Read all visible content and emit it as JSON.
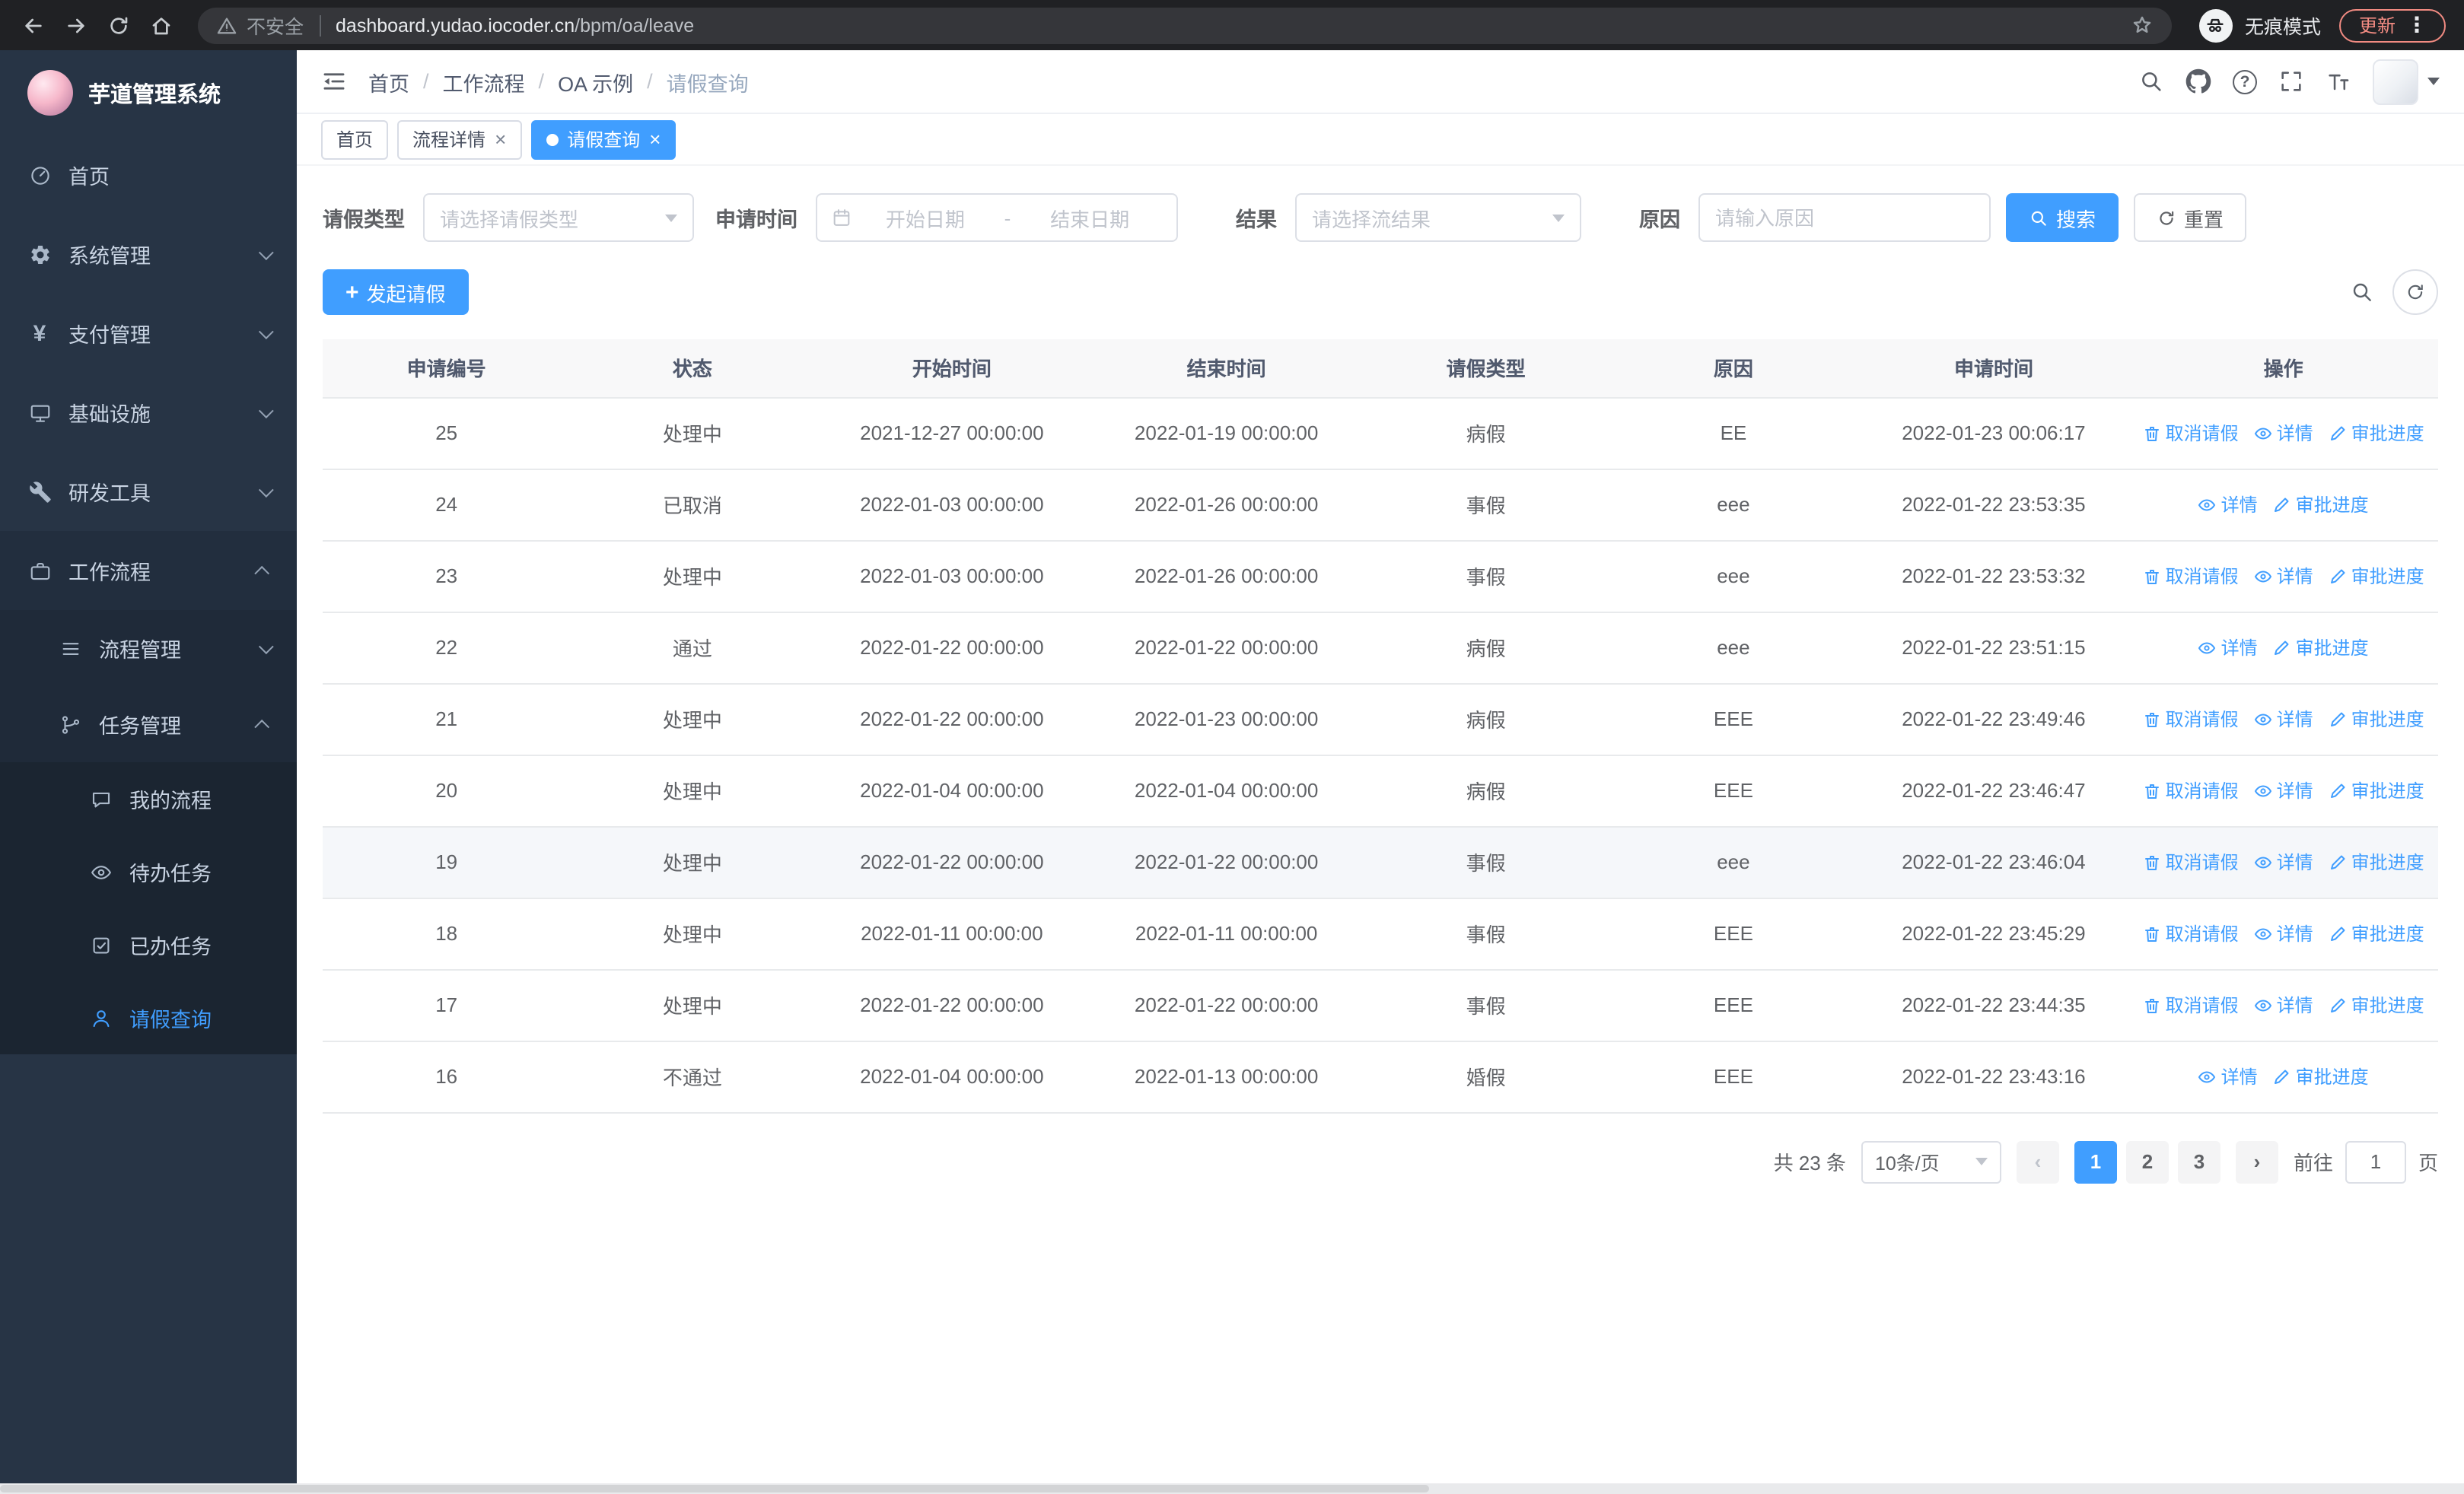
{
  "browser": {
    "security_label": "不安全",
    "url_host": "dashboard.yudao.iocoder.cn",
    "url_path": "/bpm/oa/leave",
    "incognito_label": "无痕模式",
    "update_label": "更新"
  },
  "icons": {
    "tab_close": "×",
    "plus": "+",
    "overflow_menu": "⋮",
    "pager_prev": "‹",
    "pager_next": "›",
    "help_glyph": "?",
    "yen_glyph": "¥"
  },
  "sidebar": {
    "logo_title": "芋道管理系统",
    "menu": [
      {
        "label": "首页",
        "icon": "dashboard-icon"
      },
      {
        "label": "系统管理",
        "icon": "gear-icon"
      },
      {
        "label": "支付管理",
        "icon": "yen-icon"
      },
      {
        "label": "基础设施",
        "icon": "monitor-icon"
      },
      {
        "label": "研发工具",
        "icon": "wrench-icon"
      },
      {
        "label": "工作流程",
        "icon": "briefcase-icon",
        "expanded": true
      }
    ],
    "workflow_children": [
      {
        "label": "流程管理",
        "icon": "list-icon"
      },
      {
        "label": "任务管理",
        "icon": "branch-icon",
        "expanded": true
      }
    ],
    "task_children": [
      {
        "label": "我的流程",
        "icon": "chat-icon"
      },
      {
        "label": "待办任务",
        "icon": "eye-icon"
      },
      {
        "label": "已办任务",
        "icon": "check-icon"
      },
      {
        "label": "请假查询",
        "icon": "user-icon",
        "active": true
      }
    ]
  },
  "header": {
    "breadcrumb": [
      "首页",
      "工作流程",
      "OA 示例",
      "请假查询"
    ]
  },
  "tabs": [
    {
      "label": "首页",
      "closable": false,
      "active": false
    },
    {
      "label": "流程详情",
      "closable": true,
      "active": false
    },
    {
      "label": "请假查询",
      "closable": true,
      "active": true
    }
  ],
  "filters": {
    "leave_type_label": "请假类型",
    "leave_type_placeholder": "请选择请假类型",
    "apply_time_label": "申请时间",
    "start_date_placeholder": "开始日期",
    "range_separator": "-",
    "end_date_placeholder": "结束日期",
    "result_label": "结果",
    "result_placeholder": "请选择流结果",
    "reason_label": "原因",
    "reason_placeholder": "请输入原因",
    "search_button": "搜索",
    "reset_button": "重置"
  },
  "toolbar": {
    "create_button": "发起请假"
  },
  "table": {
    "columns": [
      "申请编号",
      "状态",
      "开始时间",
      "结束时间",
      "请假类型",
      "原因",
      "申请时间",
      "操作"
    ],
    "actions": {
      "cancel": "取消请假",
      "detail": "详情",
      "progress": "审批进度"
    },
    "rows": [
      {
        "id": "25",
        "status": "处理中",
        "start": "2021-12-27 00:00:00",
        "end": "2022-01-19 00:00:00",
        "type": "病假",
        "reason": "EE",
        "applied": "2022-01-23 00:06:17",
        "cancellable": true,
        "highlighted": false
      },
      {
        "id": "24",
        "status": "已取消",
        "start": "2022-01-03 00:00:00",
        "end": "2022-01-26 00:00:00",
        "type": "事假",
        "reason": "eee",
        "applied": "2022-01-22 23:53:35",
        "cancellable": false,
        "highlighted": false
      },
      {
        "id": "23",
        "status": "处理中",
        "start": "2022-01-03 00:00:00",
        "end": "2022-01-26 00:00:00",
        "type": "事假",
        "reason": "eee",
        "applied": "2022-01-22 23:53:32",
        "cancellable": true,
        "highlighted": false
      },
      {
        "id": "22",
        "status": "通过",
        "start": "2022-01-22 00:00:00",
        "end": "2022-01-22 00:00:00",
        "type": "病假",
        "reason": "eee",
        "applied": "2022-01-22 23:51:15",
        "cancellable": false,
        "highlighted": false
      },
      {
        "id": "21",
        "status": "处理中",
        "start": "2022-01-22 00:00:00",
        "end": "2022-01-23 00:00:00",
        "type": "病假",
        "reason": "EEE",
        "applied": "2022-01-22 23:49:46",
        "cancellable": true,
        "highlighted": false
      },
      {
        "id": "20",
        "status": "处理中",
        "start": "2022-01-04 00:00:00",
        "end": "2022-01-04 00:00:00",
        "type": "病假",
        "reason": "EEE",
        "applied": "2022-01-22 23:46:47",
        "cancellable": true,
        "highlighted": false
      },
      {
        "id": "19",
        "status": "处理中",
        "start": "2022-01-22 00:00:00",
        "end": "2022-01-22 00:00:00",
        "type": "事假",
        "reason": "eee",
        "applied": "2022-01-22 23:46:04",
        "cancellable": true,
        "highlighted": true
      },
      {
        "id": "18",
        "status": "处理中",
        "start": "2022-01-11 00:00:00",
        "end": "2022-01-11 00:00:00",
        "type": "事假",
        "reason": "EEE",
        "applied": "2022-01-22 23:45:29",
        "cancellable": true,
        "highlighted": false
      },
      {
        "id": "17",
        "status": "处理中",
        "start": "2022-01-22 00:00:00",
        "end": "2022-01-22 00:00:00",
        "type": "事假",
        "reason": "EEE",
        "applied": "2022-01-22 23:44:35",
        "cancellable": true,
        "highlighted": false
      },
      {
        "id": "16",
        "status": "不通过",
        "start": "2022-01-04 00:00:00",
        "end": "2022-01-13 00:00:00",
        "type": "婚假",
        "reason": "EEE",
        "applied": "2022-01-22 23:43:16",
        "cancellable": false,
        "highlighted": false
      }
    ]
  },
  "pagination": {
    "total": "共 23 条",
    "page_size": "10条/页",
    "pages": [
      "1",
      "2",
      "3"
    ],
    "active_page": "1",
    "goto_label": "前往",
    "goto_value": "1",
    "page_suffix": "页"
  },
  "colors": {
    "accent": "#409eff",
    "sidebar_bg": "#273445",
    "sidebar_submenu_bg": "#1f2a39",
    "active_tab_bg": "#409eff",
    "table_header_bg": "#f8f8f9",
    "update_pill": "#f28b82"
  }
}
